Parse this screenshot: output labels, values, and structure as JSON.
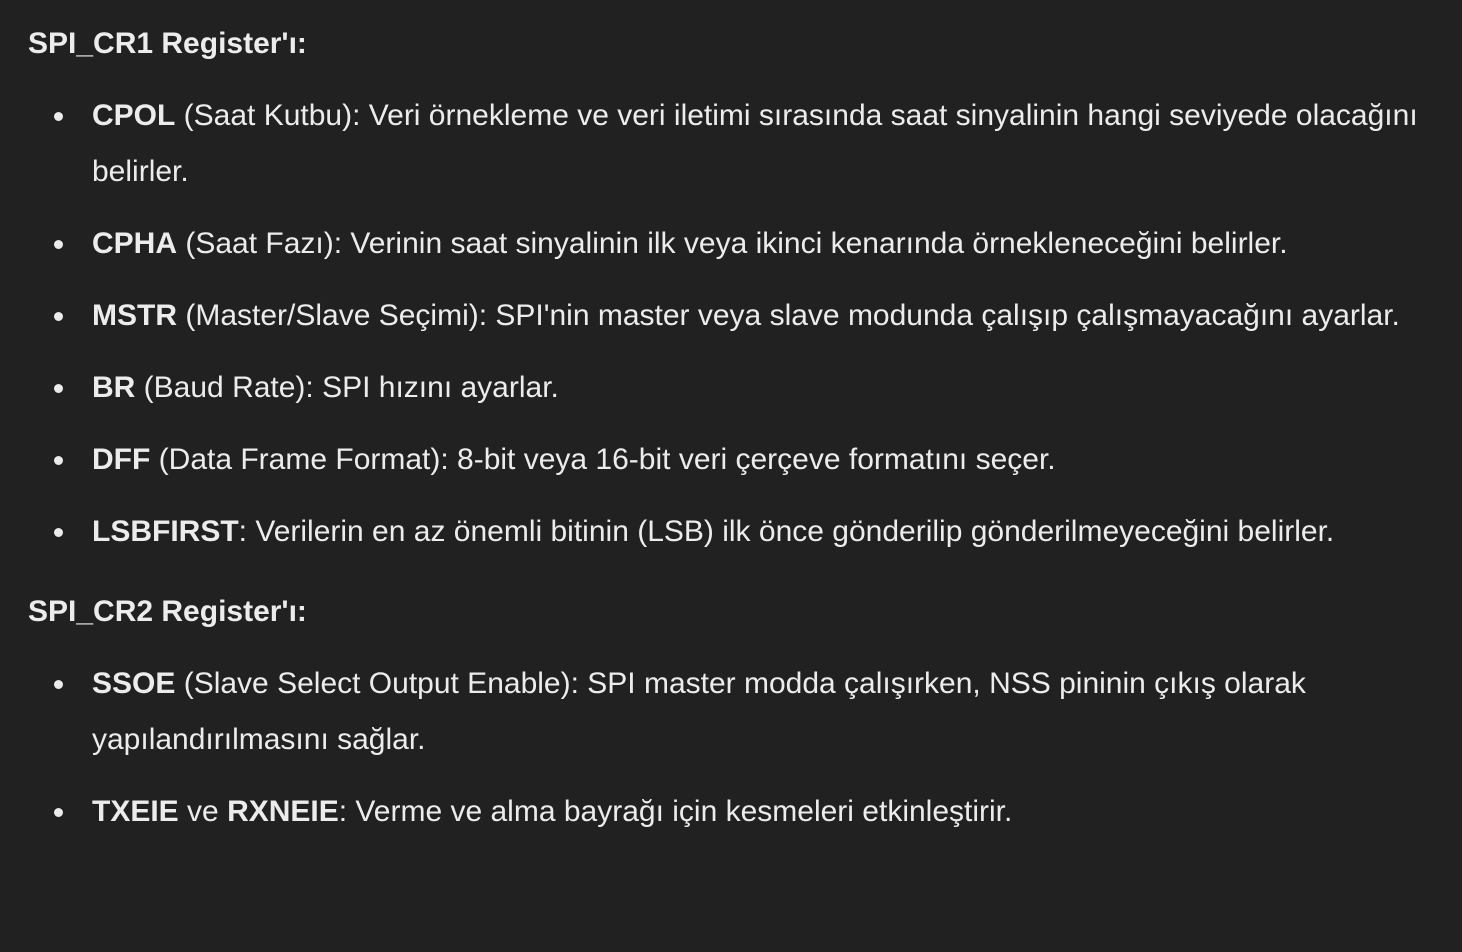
{
  "sections": [
    {
      "heading": "SPI_CR1 Register'ı:",
      "items": [
        {
          "term": "CPOL",
          "desc": " (Saat Kutbu): Veri örnekleme ve veri iletimi sırasında saat sinyalinin hangi seviyede olacağını belirler."
        },
        {
          "term": "CPHA",
          "desc": " (Saat Fazı): Verinin saat sinyalinin ilk veya ikinci kenarında örnekleneceğini belirler."
        },
        {
          "term": "MSTR",
          "desc": " (Master/Slave Seçimi): SPI'nin master veya slave modunda çalışıp çalışmayacağını ayarlar."
        },
        {
          "term": "BR",
          "desc": " (Baud Rate): SPI hızını ayarlar."
        },
        {
          "term": "DFF",
          "desc": " (Data Frame Format): 8-bit veya 16-bit veri çerçeve formatını seçer."
        },
        {
          "term": "LSBFIRST",
          "desc": ": Verilerin en az önemli bitinin (LSB) ilk önce gönderilip gönderilmeyeceğini belirler."
        }
      ]
    },
    {
      "heading": "SPI_CR2 Register'ı:",
      "items": [
        {
          "term": "SSOE",
          "desc": " (Slave Select Output Enable): SPI master modda çalışırken, NSS pininin çıkış olarak yapılandırılmasını sağlar."
        },
        {
          "term": "TXEIE",
          "mid": " ve ",
          "term2": "RXNEIE",
          "desc": ": Verme ve alma bayrağı için kesmeleri etkinleştirir."
        }
      ]
    }
  ]
}
